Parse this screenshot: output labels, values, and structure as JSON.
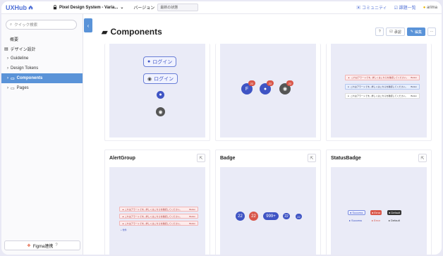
{
  "topbar": {
    "logo": "UXHub",
    "project": "Pixel Design System - Varia...",
    "version_label": "バージョン",
    "version_value": "最新の状態",
    "community": "コミュニティ",
    "task_list": "課題一覧",
    "user": "arima"
  },
  "sidebar": {
    "search_placeholder": "クイック検索",
    "items": [
      {
        "label": "概要"
      },
      {
        "label": "デザイン設計"
      },
      {
        "label": "Guideline"
      },
      {
        "label": "Design Tokens"
      },
      {
        "label": "Components"
      },
      {
        "label": "Pages"
      }
    ],
    "figma": "Figma連携"
  },
  "main": {
    "title": "Components",
    "btn_approve": "承認",
    "btn_edit": "編集"
  },
  "cards": {
    "button": {
      "label1": "ログイン",
      "label2": "ログイン"
    },
    "avatar_badge": {
      "letter": "F",
      "count": "22"
    },
    "alert_group": {
      "title": "AlertGroup",
      "line": "これはアラートです。詳しくはこちらを確認してください。",
      "action": "Button",
      "more": "+ 他件"
    },
    "badge": {
      "title": "Badge",
      "v1": "22",
      "v2": "22",
      "v3": "999+",
      "v4": "22",
      "v5": "22"
    },
    "status_badge": {
      "title": "StatusBadge",
      "s1": "Success",
      "s2": "Error",
      "s3": "Default",
      "s4": "Success",
      "s5": "Error",
      "s6": "Default"
    },
    "alert": {
      "line": "これはアラートです。詳しくはこちらを確認してください。",
      "action": "Button"
    }
  },
  "colors": {
    "accent": "#5a93d8",
    "brand": "#4f6fd6"
  }
}
